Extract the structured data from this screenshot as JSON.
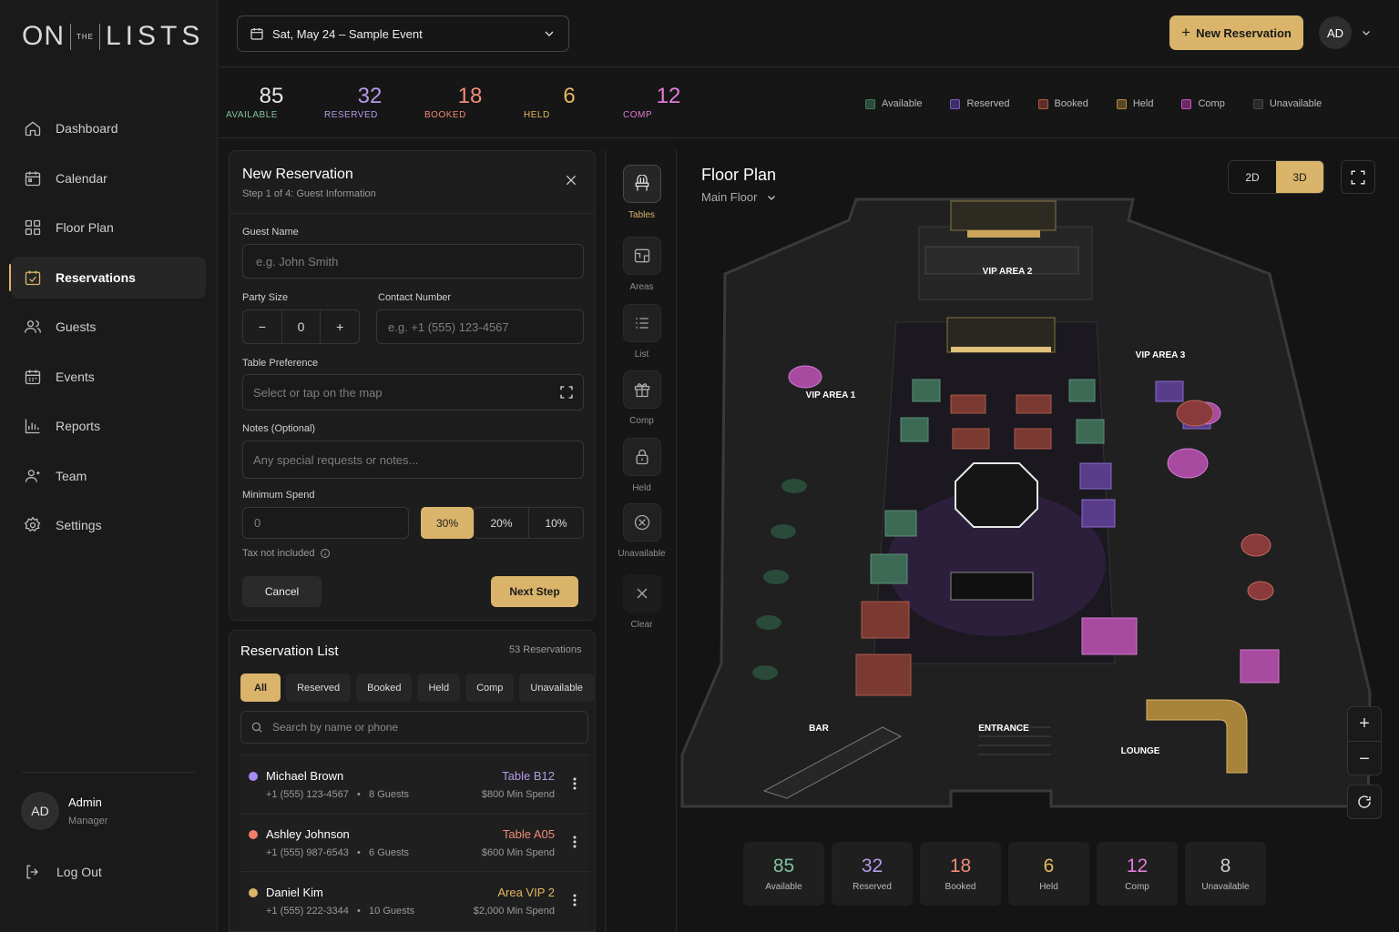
{
  "brand": {
    "on": "ON",
    "the": "THE",
    "lists": "LISTS"
  },
  "sidebar": {
    "items": [
      {
        "label": "Dashboard",
        "icon": "home-icon"
      },
      {
        "label": "Calendar",
        "icon": "calendar-icon"
      },
      {
        "label": "Floor Plan",
        "icon": "grid-icon"
      },
      {
        "label": "Reservations",
        "icon": "reservation-icon",
        "active": true
      },
      {
        "label": "Guests",
        "icon": "users-icon"
      },
      {
        "label": "Events",
        "icon": "events-icon"
      },
      {
        "label": "Reports",
        "icon": "chart-icon"
      },
      {
        "label": "Team",
        "icon": "team-icon"
      },
      {
        "label": "Settings",
        "icon": "gear-icon"
      }
    ],
    "user": {
      "initials": "AD",
      "name": "Admin",
      "role": "Manager"
    },
    "logout": "Log Out"
  },
  "header": {
    "event": "Sat, May 24  –  Sample Event",
    "new_reservation": "New Reservation",
    "avatar": "AD"
  },
  "stats": [
    {
      "value": "85",
      "label": "AVAILABLE",
      "color": "#e6e6e6",
      "labelColor": "#7fc2a0"
    },
    {
      "value": "32",
      "label": "RESERVED",
      "color": "#b39be8",
      "labelColor": "#b39be8"
    },
    {
      "value": "18",
      "label": "BOOKED",
      "color": "#ef8a78",
      "labelColor": "#ef8a78"
    },
    {
      "value": "6",
      "label": "HELD",
      "color": "#e5b85f",
      "labelColor": "#e5b85f"
    },
    {
      "value": "12",
      "label": "COMP",
      "color": "#e17ad8",
      "labelColor": "#e17ad8"
    }
  ],
  "legend": [
    {
      "label": "Available",
      "color": "#3f7a5c"
    },
    {
      "label": "Reserved",
      "color": "#7a5cc7"
    },
    {
      "label": "Booked",
      "color": "#b25a4a"
    },
    {
      "label": "Held",
      "color": "#b08a3c"
    },
    {
      "label": "Comp",
      "color": "#c850c0"
    },
    {
      "label": "Unavailable",
      "color": "#4a4a4a"
    }
  ],
  "form": {
    "title": "New Reservation",
    "step": "Step 1 of 4: Guest Information",
    "guest_name_label": "Guest Name",
    "guest_name_placeholder": "e.g. John Smith",
    "party_size_label": "Party Size",
    "party_size_value": "0",
    "contact_label": "Contact Number",
    "contact_placeholder": "e.g. +1 (555) 123-4567",
    "table_pref_label": "Table Preference",
    "table_pref_placeholder": "Select or tap on the map",
    "notes_label": "Notes (Optional)",
    "notes_placeholder": "Any special requests or notes...",
    "min_spend_label": "Minimum Spend",
    "min_spend_value": "0",
    "pct_options": [
      "30%",
      "20%",
      "10%"
    ],
    "tax_note": "Tax not included",
    "cancel": "Cancel",
    "next": "Next Step"
  },
  "list": {
    "title": "Reservation List",
    "count": "53 Reservations",
    "filters": [
      "All",
      "Reserved",
      "Booked",
      "Held",
      "Comp",
      "Unavailable"
    ],
    "search_placeholder": "Search by name or phone",
    "rows": [
      {
        "name": "Michael Brown",
        "phone": "+1 (555) 123-4567",
        "guests": "8 Guests",
        "table": "Table B12",
        "spend": "$800 Min Spend",
        "color": "#a78bfa"
      },
      {
        "name": "Ashley Johnson",
        "phone": "+1 (555) 987-6543",
        "guests": "6 Guests",
        "table": "Table A05",
        "spend": "$600 Min Spend",
        "color": "#ef7e6a"
      },
      {
        "name": "Daniel Kim",
        "phone": "+1 (555) 222-3344",
        "guests": "10 Guests",
        "table": "Area VIP 2",
        "spend": "$2,000 Min Spend",
        "color": "#d9b46a"
      }
    ]
  },
  "tools": [
    {
      "label": "Tables",
      "icon": "chair-icon"
    },
    {
      "label": "Areas",
      "icon": "area-icon"
    },
    {
      "label": "List",
      "icon": "list-icon"
    },
    {
      "label": "Comp",
      "icon": "gift-icon"
    },
    {
      "label": "Held",
      "icon": "lock-icon"
    },
    {
      "label": "Unavailable",
      "icon": "block-icon"
    },
    {
      "label": "Clear",
      "icon": "close-icon"
    }
  ],
  "floorplan": {
    "title": "Floor Plan",
    "floor": "Main Floor",
    "view_2d": "2D",
    "view_3d": "3D",
    "areas": [
      "VIP AREA 2",
      "VIP AREA 1",
      "VIP AREA 3",
      "BAR",
      "ENTRANCE",
      "LOUNGE"
    ],
    "bottom_stats": [
      {
        "value": "85",
        "label": "Available",
        "color": "#7fc2a0"
      },
      {
        "value": "32",
        "label": "Reserved",
        "color": "#b39be8"
      },
      {
        "value": "18",
        "label": "Booked",
        "color": "#ef8a78"
      },
      {
        "value": "6",
        "label": "Held",
        "color": "#e5b85f"
      },
      {
        "value": "12",
        "label": "Comp",
        "color": "#e17ad8"
      },
      {
        "value": "8",
        "label": "Unavailable",
        "color": "#cfcfcf"
      }
    ]
  }
}
